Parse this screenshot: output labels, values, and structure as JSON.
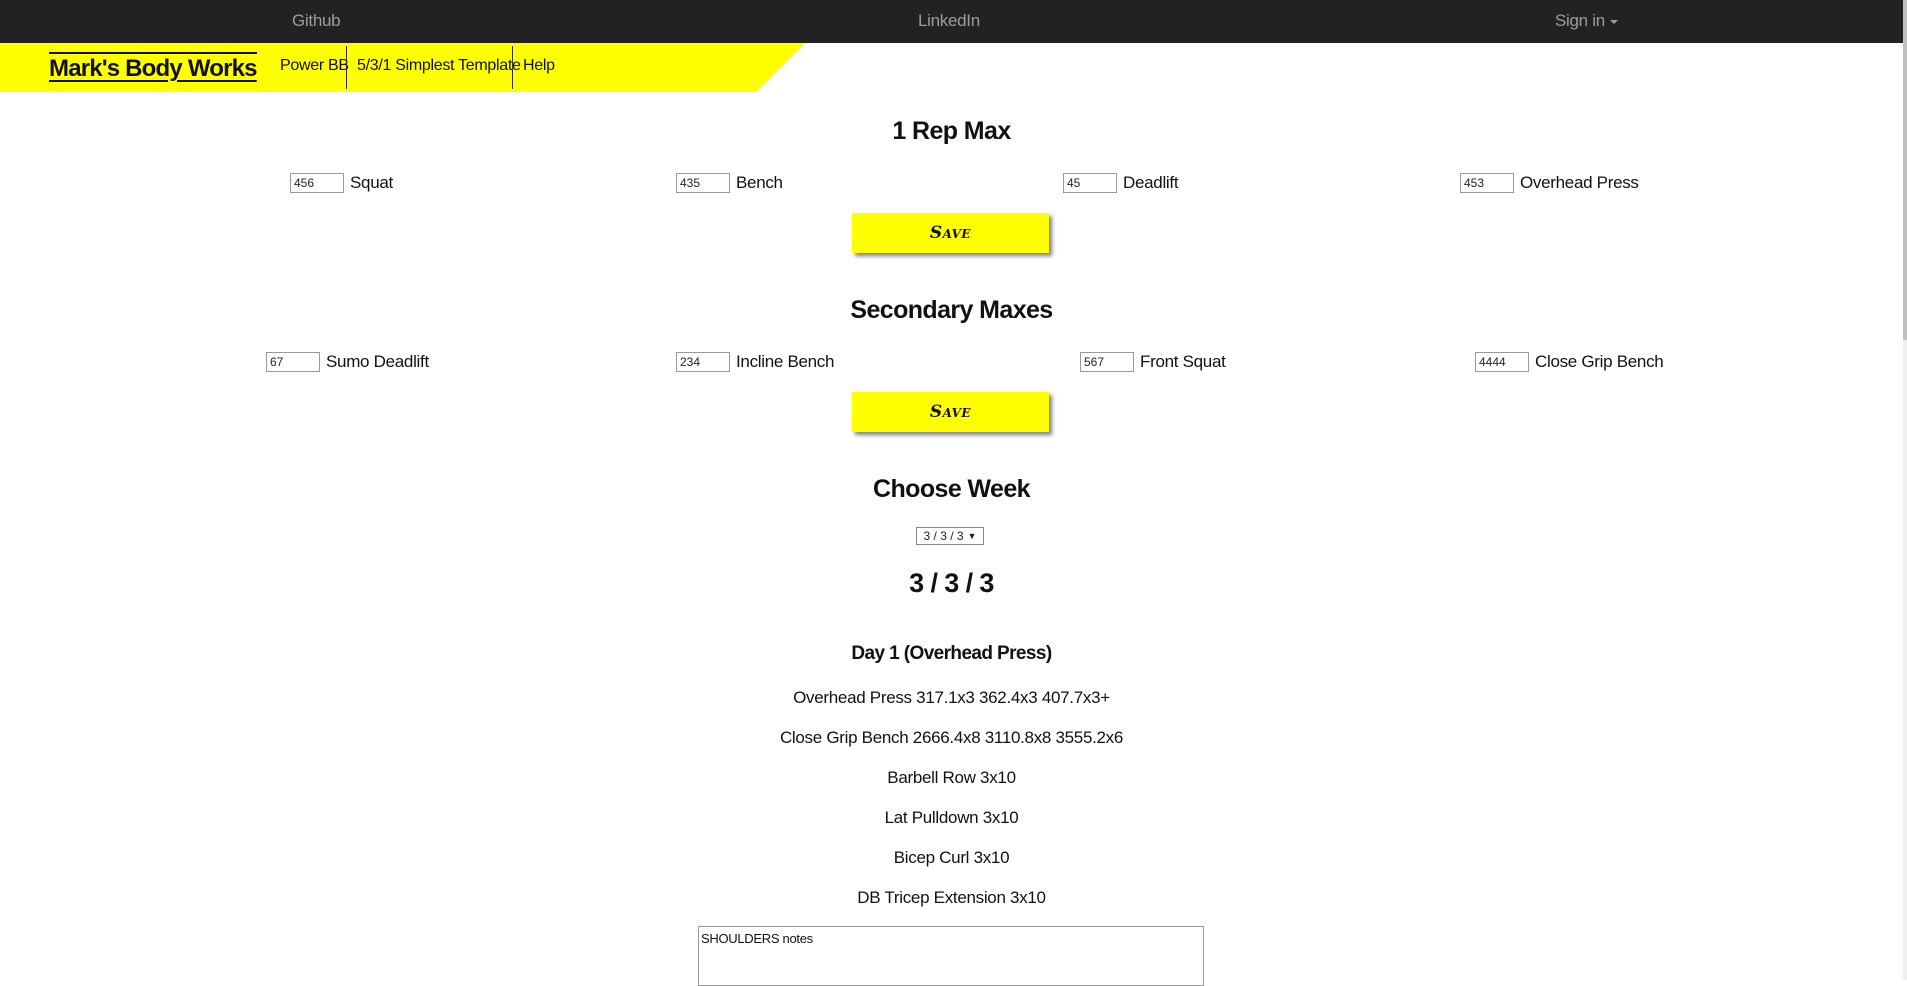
{
  "topnav": {
    "github": "Github",
    "linkedin": "LinkedIn",
    "signin": "Sign in"
  },
  "nav": {
    "brand": "Mark's Body Works",
    "items": [
      "Power BB",
      "5/3/1 Simplest Template",
      "Help"
    ]
  },
  "one_rep_max": {
    "title": "1 Rep Max",
    "fields": [
      {
        "value": "456",
        "label": "Squat"
      },
      {
        "value": "435",
        "label": "Bench"
      },
      {
        "value": "45",
        "label": "Deadlift"
      },
      {
        "value": "453",
        "label": "Overhead Press"
      }
    ],
    "save_label": "Save"
  },
  "secondary_maxes": {
    "title": "Secondary Maxes",
    "fields": [
      {
        "value": "67",
        "label": "Sumo Deadlift"
      },
      {
        "value": "234",
        "label": "Incline Bench"
      },
      {
        "value": "567",
        "label": "Front Squat"
      },
      {
        "value": "4444",
        "label": "Close Grip Bench"
      }
    ],
    "save_label": "Save"
  },
  "choose_week": {
    "title": "Choose Week",
    "selected": "3 / 3 / 3"
  },
  "week": {
    "title": "3 / 3 / 3",
    "day_title": "Day 1 (Overhead Press)",
    "exercises": [
      "Overhead Press 317.1x3 362.4x3 407.7x3+",
      "Close Grip Bench 2666.4x8 3110.8x8 3555.2x6",
      "Barbell Row 3x10",
      "Lat Pulldown 3x10",
      "Bicep Curl 3x10",
      "DB Tricep Extension 3x10"
    ],
    "notes": "SHOULDERS notes"
  },
  "colors": {
    "accent": "#ffff00",
    "topbar": "#222222",
    "topbar_text": "#9d9d9d"
  }
}
